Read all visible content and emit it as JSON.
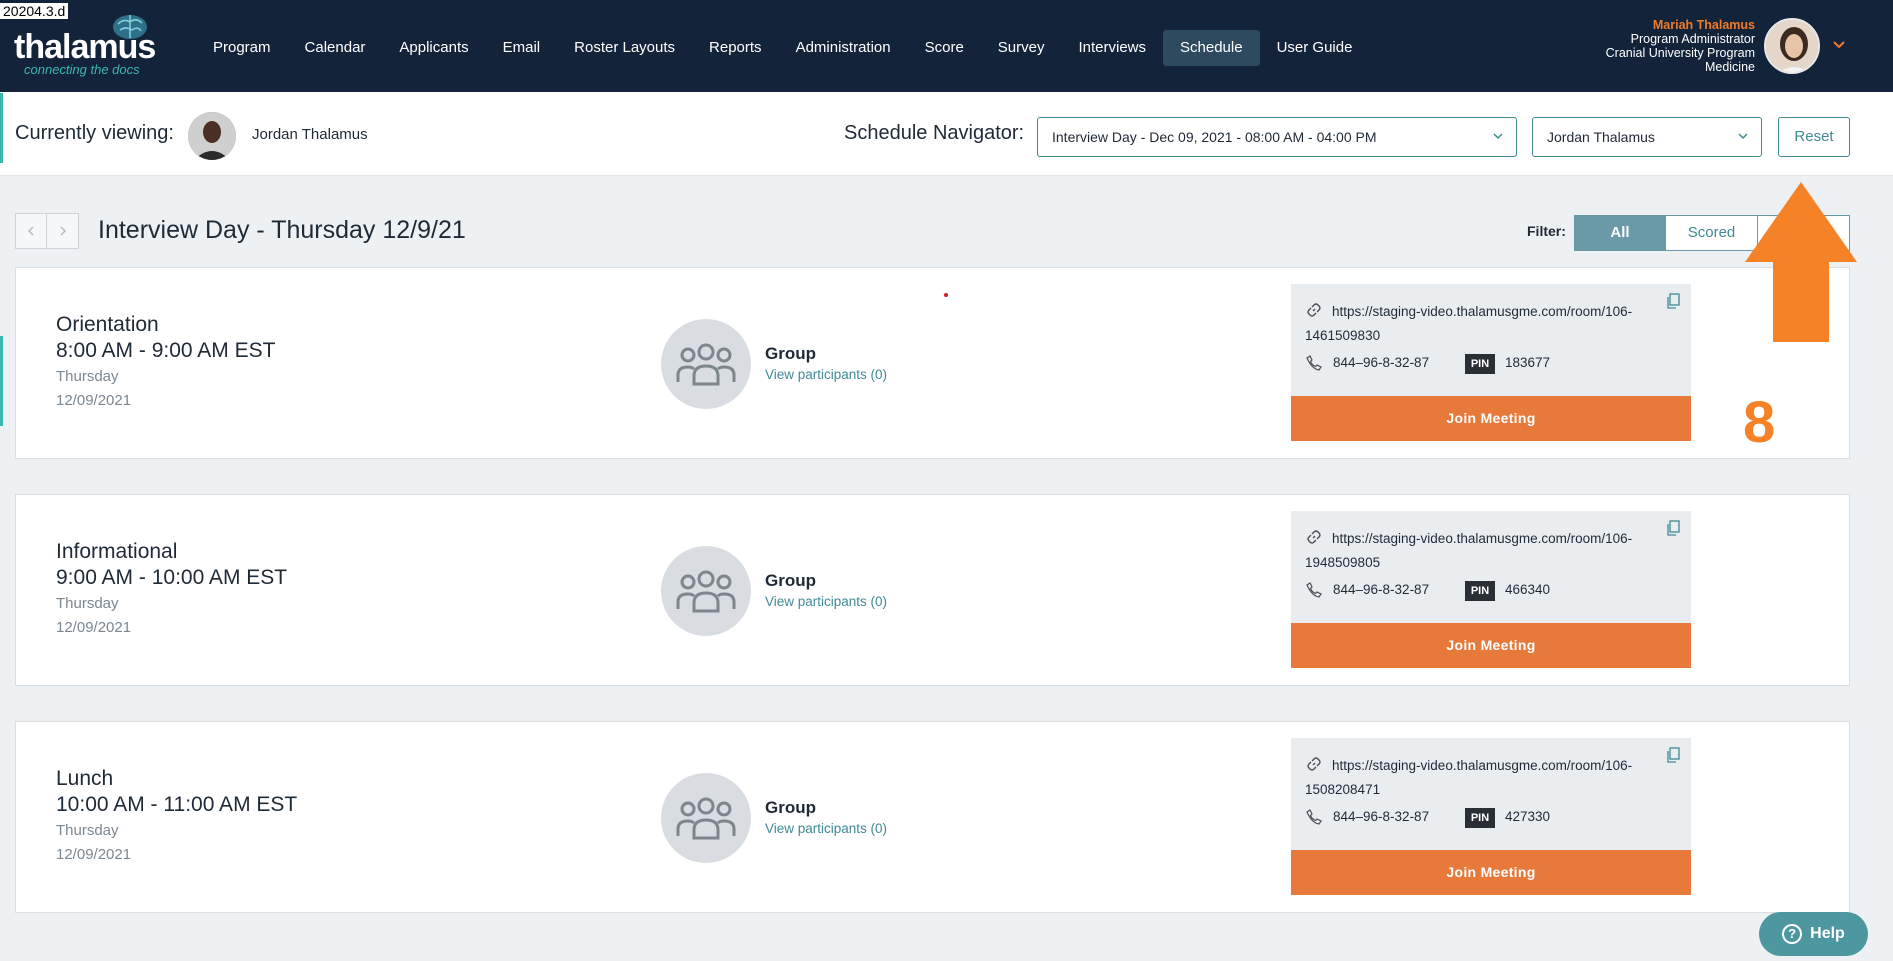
{
  "version_tag": "20204.3.d",
  "brand": {
    "name": "thalamus",
    "tagline": "connecting the docs"
  },
  "nav": {
    "items": [
      {
        "label": "Program"
      },
      {
        "label": "Calendar"
      },
      {
        "label": "Applicants"
      },
      {
        "label": "Email"
      },
      {
        "label": "Roster Layouts"
      },
      {
        "label": "Reports"
      },
      {
        "label": "Administration"
      },
      {
        "label": "Score"
      },
      {
        "label": "Survey"
      },
      {
        "label": "Interviews"
      },
      {
        "label": "Schedule",
        "active": true
      },
      {
        "label": "User Guide"
      }
    ]
  },
  "user": {
    "name": "Mariah Thalamus",
    "role": "Program Administrator",
    "org_line1": "Cranial University Program",
    "org_line2": "Medicine"
  },
  "viewing": {
    "label": "Currently viewing:",
    "name": "Jordan Thalamus",
    "navigator_label": "Schedule Navigator:",
    "day_select": "Interview Day - Dec 09, 2021 - 08:00 AM - 04:00 PM",
    "person_select": "Jordan Thalamus",
    "reset_label": "Reset"
  },
  "schedule": {
    "title": "Interview Day - Thursday 12/9/21",
    "filter_label": "Filter:",
    "filters": [
      "All",
      "Scored"
    ],
    "active_filter": "All"
  },
  "events": [
    {
      "title": "Orientation",
      "time": "8:00 AM - 9:00 AM EST",
      "day": "Thursday",
      "date": "12/09/2021",
      "group_label": "Group",
      "participants_link": "View participants (0)",
      "url": "https://staging-video.thalamusgme.com/room/106-1461509830",
      "phone": "844–96-8-32-87",
      "pin_label": "PIN",
      "pin": "183677",
      "join_label": "Join Meeting"
    },
    {
      "title": "Informational",
      "time": "9:00 AM - 10:00 AM EST",
      "day": "Thursday",
      "date": "12/09/2021",
      "group_label": "Group",
      "participants_link": "View participants (0)",
      "url": "https://staging-video.thalamusgme.com/room/106-1948509805",
      "phone": "844–96-8-32-87",
      "pin_label": "PIN",
      "pin": "466340",
      "join_label": "Join Meeting"
    },
    {
      "title": "Lunch",
      "time": "10:00 AM - 11:00 AM EST",
      "day": "Thursday",
      "date": "12/09/2021",
      "group_label": "Group",
      "participants_link": "View participants (0)",
      "url": "https://staging-video.thalamusgme.com/room/106-1508208471",
      "phone": "844–96-8-32-87",
      "pin_label": "PIN",
      "pin": "427330",
      "join_label": "Join Meeting"
    }
  ],
  "annotation": {
    "number": "8",
    "color": "#f58226"
  },
  "help": {
    "label": "Help"
  },
  "colors": {
    "nav_bg": "#13243a",
    "accent_teal": "#3f8a95",
    "join_orange": "#e7793a",
    "user_name": "#f07b2b"
  }
}
